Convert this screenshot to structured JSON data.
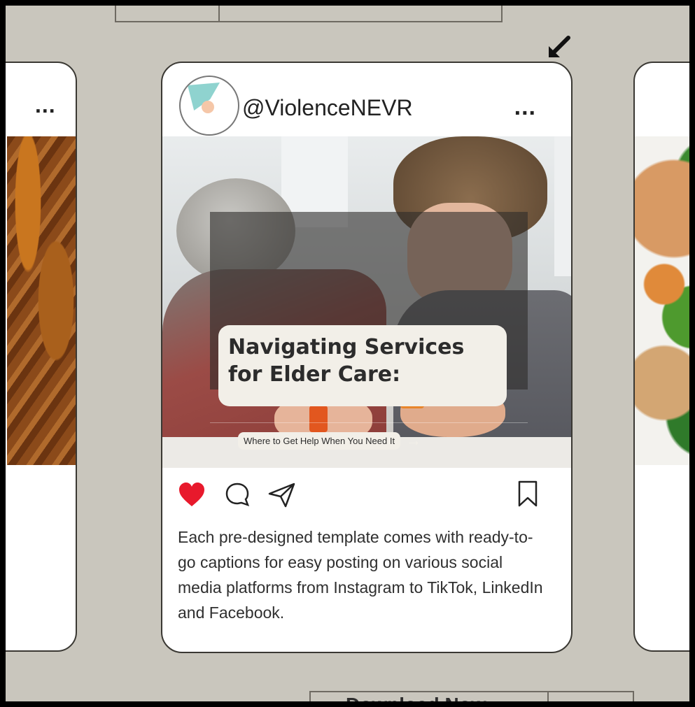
{
  "post": {
    "username": "@ViolenceNEVR",
    "more_icon": "more-dots-icon",
    "headline": "Navigating Services\nfor Elder Care:",
    "subheadline": "Where to Get Help When You Need It",
    "subheadline_arrow": "→",
    "liked": true,
    "caption": "Each pre-designed template comes with ready-to-go captions for easy posting on various social media platforms from Instagram to TikTok, LinkedIn and Facebook."
  },
  "side_cards": {
    "left_menu": "...",
    "right_menu": ""
  },
  "download": {
    "label": "Download Now"
  },
  "colors": {
    "background": "#c9c6bd",
    "heart": "#e8192c",
    "card": "#ffffff"
  }
}
